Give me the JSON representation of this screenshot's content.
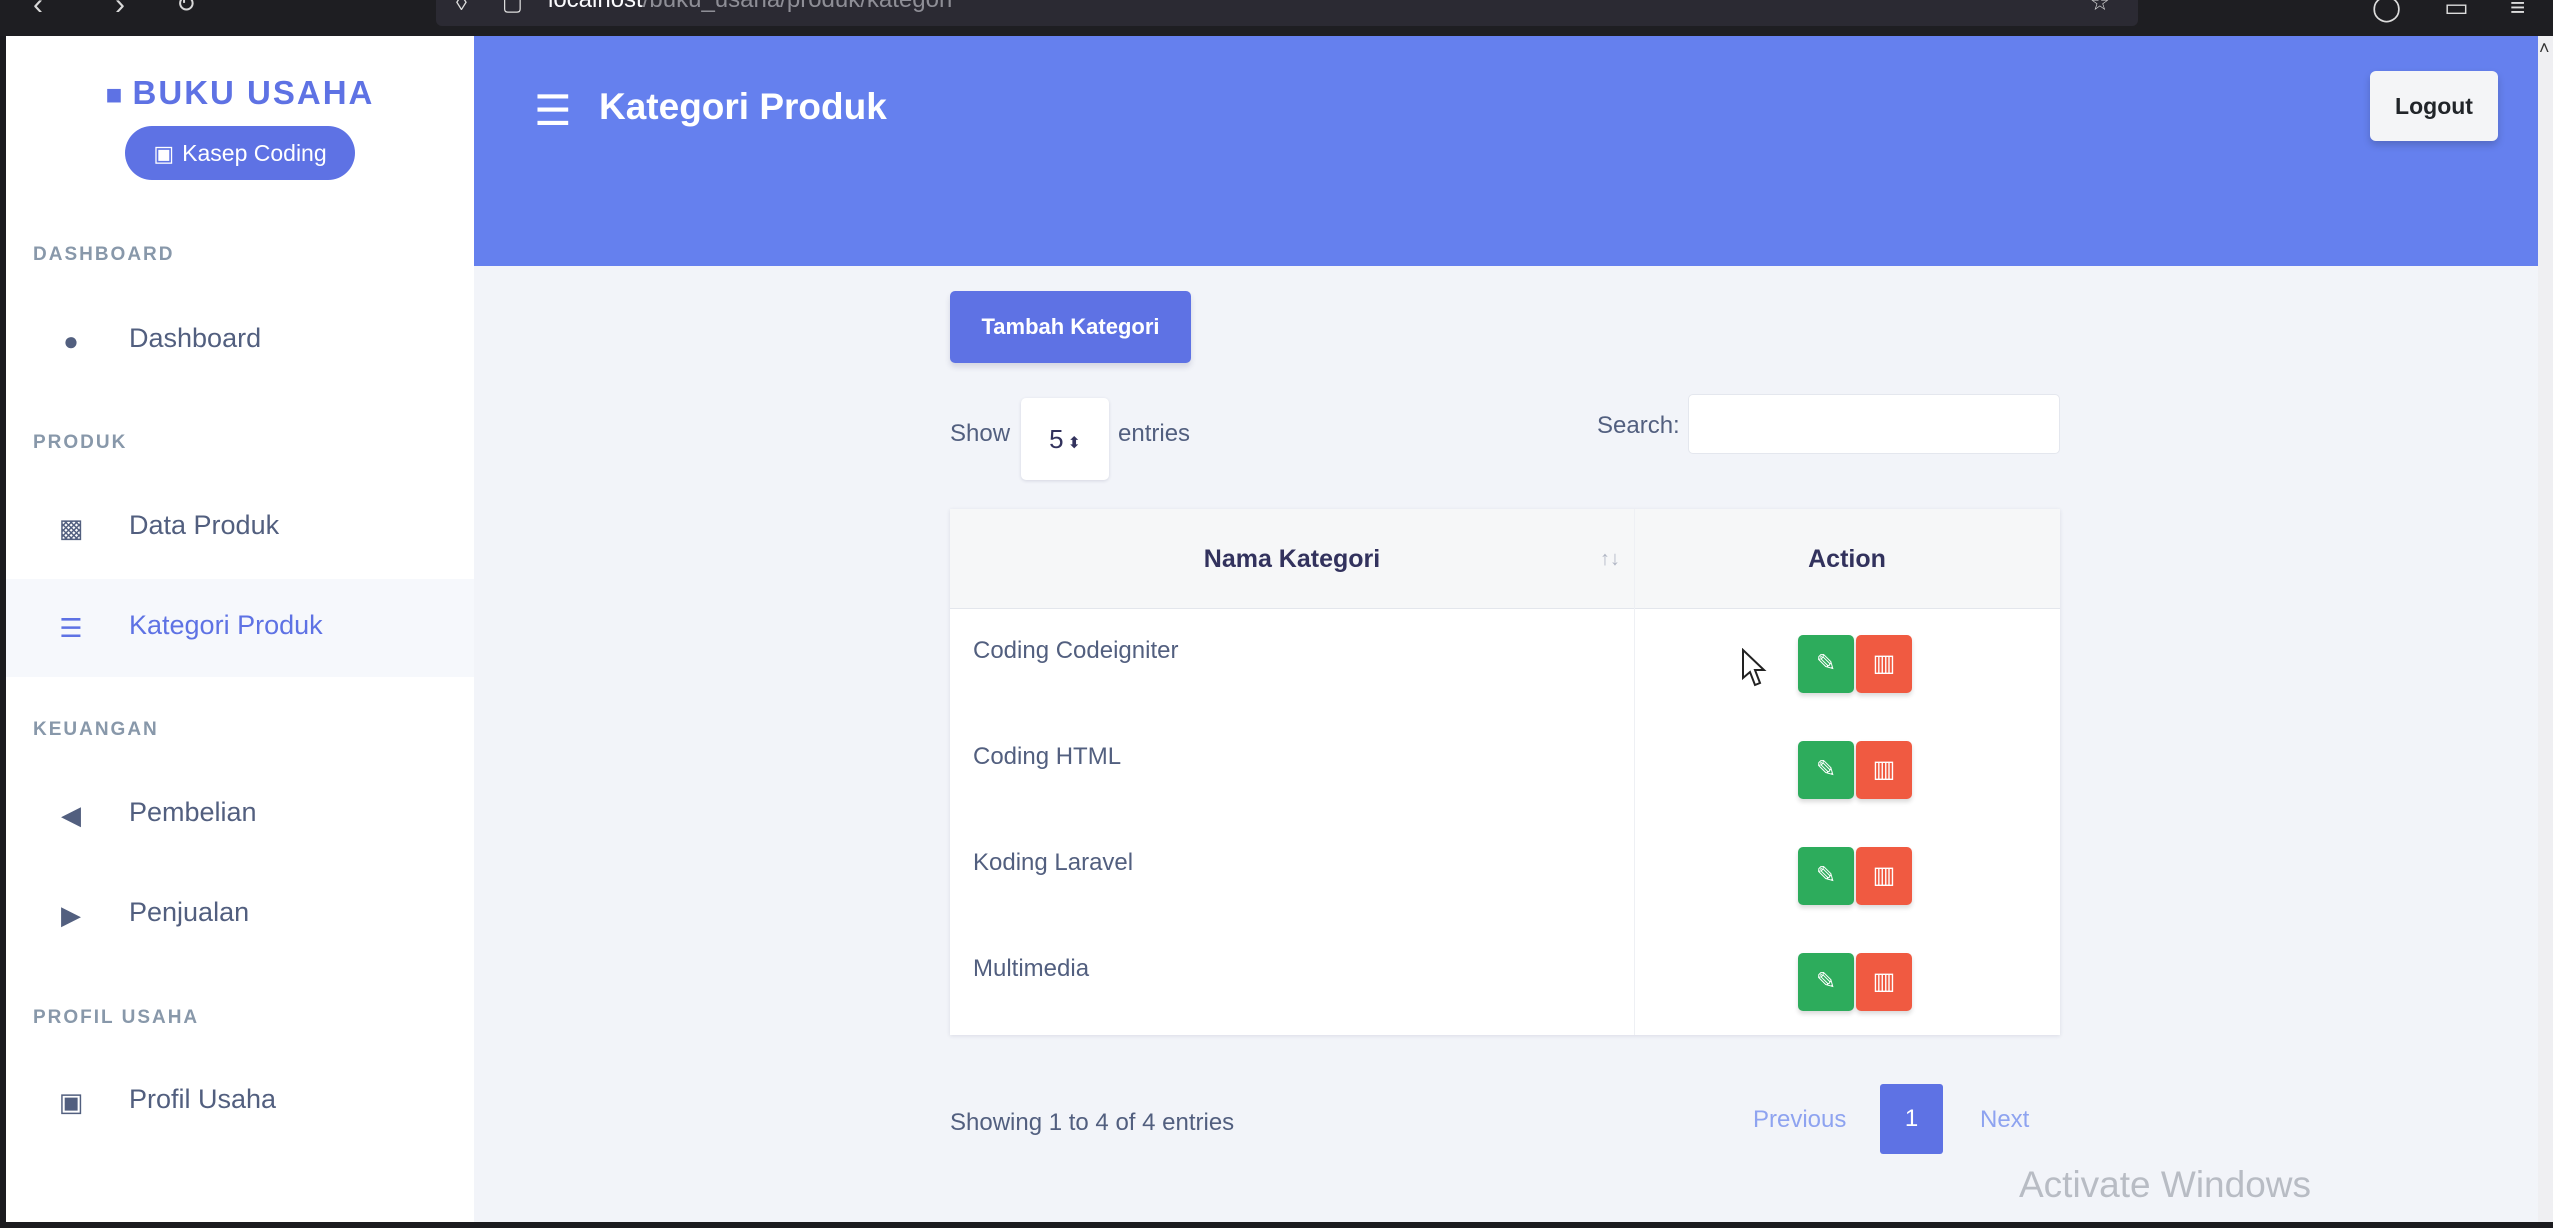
{
  "browser": {
    "url_host": "localhost",
    "url_path": "/buku_usaha/produk/kategori"
  },
  "sidebar": {
    "brand": "BUKU USAHA",
    "store_name": "Kasep Coding",
    "sections": [
      {
        "title": "DASHBOARD",
        "items": [
          {
            "label": "Dashboard",
            "icon": "flame-icon"
          }
        ]
      },
      {
        "title": "PRODUK",
        "items": [
          {
            "label": "Data Produk",
            "icon": "boxes-icon"
          },
          {
            "label": "Kategori Produk",
            "icon": "list-icon",
            "active": true
          }
        ]
      },
      {
        "title": "KEUANGAN",
        "items": [
          {
            "label": "Pembelian",
            "icon": "circle-arrow-left-icon"
          },
          {
            "label": "Penjualan",
            "icon": "circle-arrow-right-icon"
          }
        ]
      },
      {
        "title": "PROFIL USAHA",
        "items": [
          {
            "label": "Profil Usaha",
            "icon": "store-icon"
          }
        ]
      }
    ]
  },
  "header": {
    "title": "Kategori Produk",
    "logout_label": "Logout"
  },
  "content": {
    "add_button": "Tambah Kategori",
    "show_label": "Show",
    "page_length": "5",
    "entries_label": "entries",
    "search_label": "Search:",
    "search_value": "",
    "table": {
      "columns": [
        "Nama Kategori",
        "Action"
      ],
      "rows": [
        "Coding Codeigniter",
        "Coding HTML",
        "Koding Laravel",
        "Multimedia"
      ]
    },
    "info": "Showing 1 to 4 of 4 entries",
    "pagination": {
      "previous": "Previous",
      "current": "1",
      "next": "Next"
    }
  },
  "watermark": "Activate Windows",
  "colors": {
    "primary": "#5e72e4",
    "header_bg": "#6580ee",
    "edit": "#2dac5c",
    "delete": "#f05a41"
  }
}
